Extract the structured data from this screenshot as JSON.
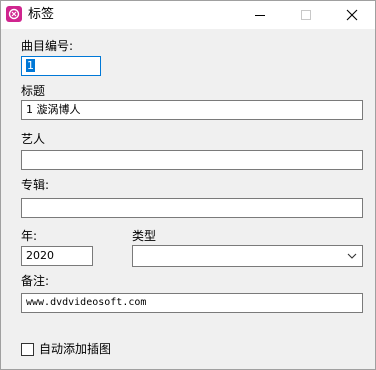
{
  "window": {
    "title": "标签"
  },
  "form": {
    "track_number": {
      "label": "曲目编号:",
      "value": "1"
    },
    "title": {
      "label": "标题",
      "value": "1 漩涡博人"
    },
    "artist": {
      "label": "艺人",
      "value": ""
    },
    "album": {
      "label": "专辑:",
      "value": ""
    },
    "year": {
      "label": "年:",
      "value": "2020"
    },
    "genre": {
      "label": "类型",
      "value": ""
    },
    "comment": {
      "label": "备注:",
      "value": "www.dvdvideosoft.com"
    },
    "auto_cover": {
      "label": "自动添加插图",
      "checked": false
    }
  },
  "colors": {
    "accent": "#0078d7",
    "app_icon": "#d0258f"
  },
  "icons": [
    "app-icon",
    "minimize-icon",
    "maximize-icon",
    "close-icon",
    "chevron-down-icon"
  ]
}
